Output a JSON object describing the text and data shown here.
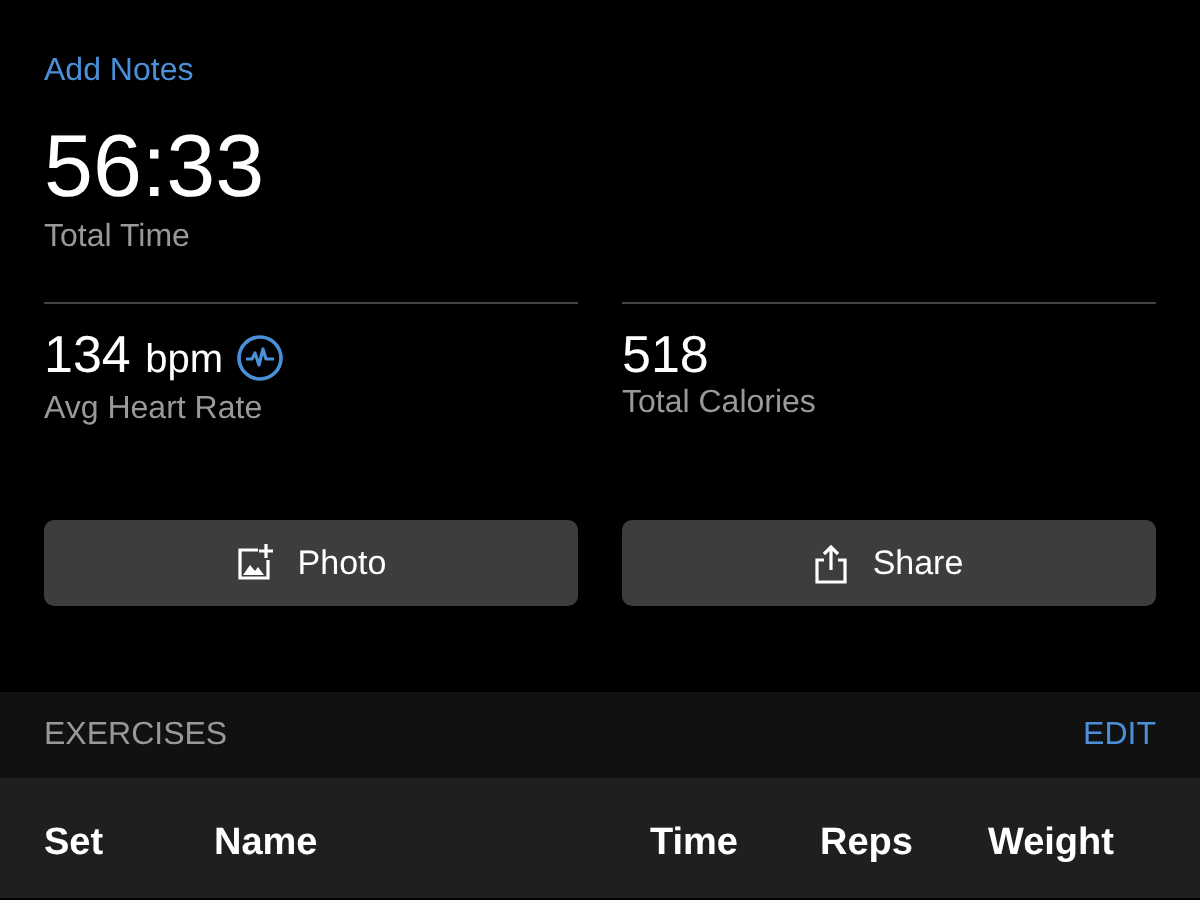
{
  "add_notes": "Add Notes",
  "total_time": {
    "value": "56:33",
    "label": "Total Time"
  },
  "stats": [
    {
      "value": "134",
      "unit": "bpm",
      "label": "Avg Heart Rate",
      "kind": "heart"
    },
    {
      "value": "518",
      "label": "Total Calories",
      "kind": "plain"
    }
  ],
  "buttons": [
    {
      "label": "Photo",
      "kind": "photo"
    },
    {
      "label": "Share",
      "kind": "share"
    }
  ],
  "exercises": {
    "title": "EXERCISES",
    "action": "EDIT",
    "columns": [
      "Set",
      "Name",
      "Time",
      "Reps",
      "Weight"
    ]
  }
}
